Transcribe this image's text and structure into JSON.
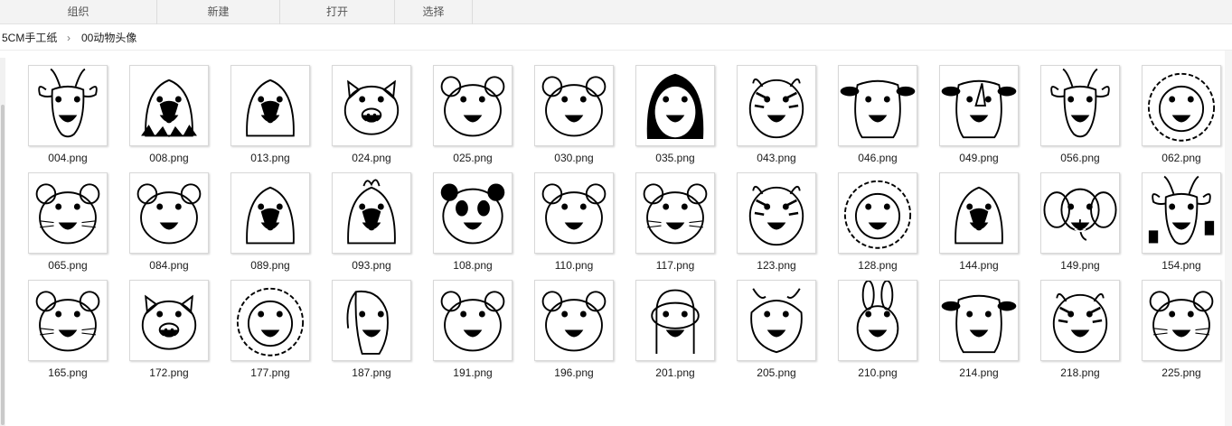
{
  "toolbar": {
    "groups": [
      {
        "label": "组织"
      },
      {
        "label": "新建"
      },
      {
        "label": "打开"
      },
      {
        "label": "选择"
      }
    ]
  },
  "breadcrumb": {
    "items": [
      "5CM手工纸",
      "00动物头像"
    ],
    "separator": "›"
  },
  "files": [
    {
      "name": "004.png",
      "icon": "antelope-head-icon"
    },
    {
      "name": "008.png",
      "icon": "eagle-head-icon"
    },
    {
      "name": "013.png",
      "icon": "parrot-head-icon"
    },
    {
      "name": "024.png",
      "icon": "pig-head-icon"
    },
    {
      "name": "025.png",
      "icon": "gorilla-head-icon"
    },
    {
      "name": "030.png",
      "icon": "monkey-head-icon"
    },
    {
      "name": "035.png",
      "icon": "penguin-head-icon"
    },
    {
      "name": "043.png",
      "icon": "zebra-head-icon"
    },
    {
      "name": "046.png",
      "icon": "hippo-head-icon"
    },
    {
      "name": "049.png",
      "icon": "rhino-head-icon"
    },
    {
      "name": "056.png",
      "icon": "deer-head-icon"
    },
    {
      "name": "062.png",
      "icon": "hedgehog-head-icon"
    },
    {
      "name": "065.png",
      "icon": "hamster-head-icon"
    },
    {
      "name": "084.png",
      "icon": "bear-head-icon"
    },
    {
      "name": "089.png",
      "icon": "duck-head-icon"
    },
    {
      "name": "093.png",
      "icon": "rooster-head-icon"
    },
    {
      "name": "108.png",
      "icon": "panda-head-icon"
    },
    {
      "name": "110.png",
      "icon": "bear-cub-head-icon"
    },
    {
      "name": "117.png",
      "icon": "fox-head-icon"
    },
    {
      "name": "123.png",
      "icon": "leopard-head-icon"
    },
    {
      "name": "128.png",
      "icon": "lion-head-icon"
    },
    {
      "name": "144.png",
      "icon": "chick-head-icon"
    },
    {
      "name": "149.png",
      "icon": "elephant-head-icon"
    },
    {
      "name": "154.png",
      "icon": "giraffe-head-icon"
    },
    {
      "name": "165.png",
      "icon": "cat-head-icon"
    },
    {
      "name": "172.png",
      "icon": "piglet-head-icon"
    },
    {
      "name": "177.png",
      "icon": "poodle-head-icon"
    },
    {
      "name": "187.png",
      "icon": "horse-head-icon"
    },
    {
      "name": "191.png",
      "icon": "chimp-head-icon"
    },
    {
      "name": "196.png",
      "icon": "sheep-head-icon"
    },
    {
      "name": "201.png",
      "icon": "snake-head-icon"
    },
    {
      "name": "205.png",
      "icon": "dragon-head-icon"
    },
    {
      "name": "210.png",
      "icon": "rabbit-head-icon"
    },
    {
      "name": "214.png",
      "icon": "cow-head-icon"
    },
    {
      "name": "218.png",
      "icon": "tiger-head-icon"
    },
    {
      "name": "225.png",
      "icon": "mouse-head-icon"
    }
  ]
}
